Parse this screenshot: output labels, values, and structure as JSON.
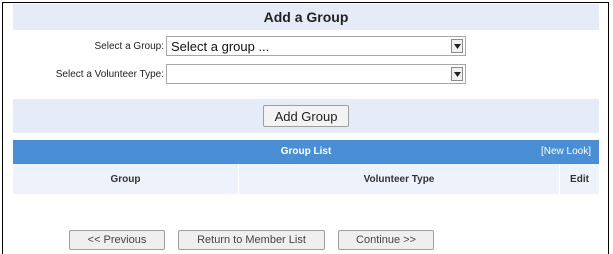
{
  "add_section": {
    "title": "Add a Group",
    "group_label": "Select a Group:",
    "group_value": "Select a group ...",
    "volunteer_label": "Select a Volunteer Type:",
    "volunteer_value": "",
    "add_button": "Add Group"
  },
  "group_list": {
    "title": "Group List",
    "new_look_link": "[New Look]",
    "columns": [
      "Group",
      "Volunteer Type",
      "Edit"
    ]
  },
  "navigation": {
    "previous": "<< Previous",
    "return": "Return to Member List",
    "continue": "Continue >>"
  },
  "icons": {
    "dropdown": "chevron-down-icon"
  },
  "colors": {
    "section_bg": "#e6ecf7",
    "list_header_bg": "#4a8fd6",
    "column_header_bg": "#eef2fa"
  }
}
